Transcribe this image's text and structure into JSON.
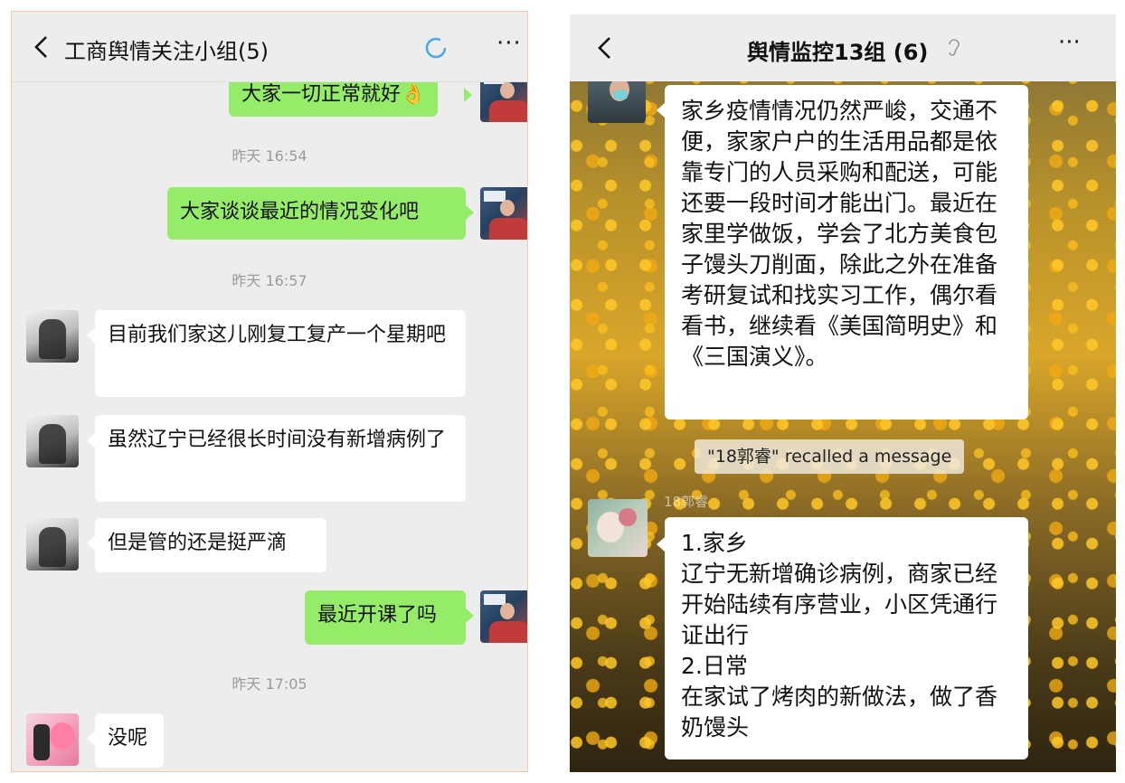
{
  "left": {
    "title": "工商舆情关注小组(5)",
    "more": "···",
    "messages": {
      "m0": "大家一切正常就好👌",
      "ts1": "昨天 16:54",
      "m1": "大家谈谈最近的情况变化吧",
      "ts2": "昨天 16:57",
      "m2": "目前我们家这儿刚复工复产一个星期吧",
      "m3": "虽然辽宁已经很长时间没有新增病例了",
      "m4": "但是管的还是挺严滴",
      "m5": "最近开课了吗",
      "ts3": "昨天 17:05",
      "m6": "没呢"
    }
  },
  "right": {
    "title": "舆情监控13组 (6)",
    "more": "···",
    "messages": {
      "r1": "家乡疫情情况仍然严峻，交通不便，家家户户的生活用品都是依靠专门的人员采购和配送，可能还要一段时间才能出门。最近在家里学做饭，学会了北方美食包子馒头刀削面，除此之外在准备考研复试和找实习工作，偶尔看看书，继续看《美国简明史》和《三国演义》。",
      "recall": "\"18郭睿\" recalled a message",
      "sender": "18郭睿",
      "r2_line1": "1.家乡",
      "r2_line2": "辽宁无新增确诊病例，商家已经开始陆续有序营业，小区凭通行证出行",
      "r2_line3": "2.日常",
      "r2_line4": "在家试了烤肉的新做法，做了香奶馒头"
    }
  },
  "colors": {
    "self_bubble": "#95ec69",
    "other_bubble": "#ffffff",
    "chat_bg": "#ededed"
  }
}
